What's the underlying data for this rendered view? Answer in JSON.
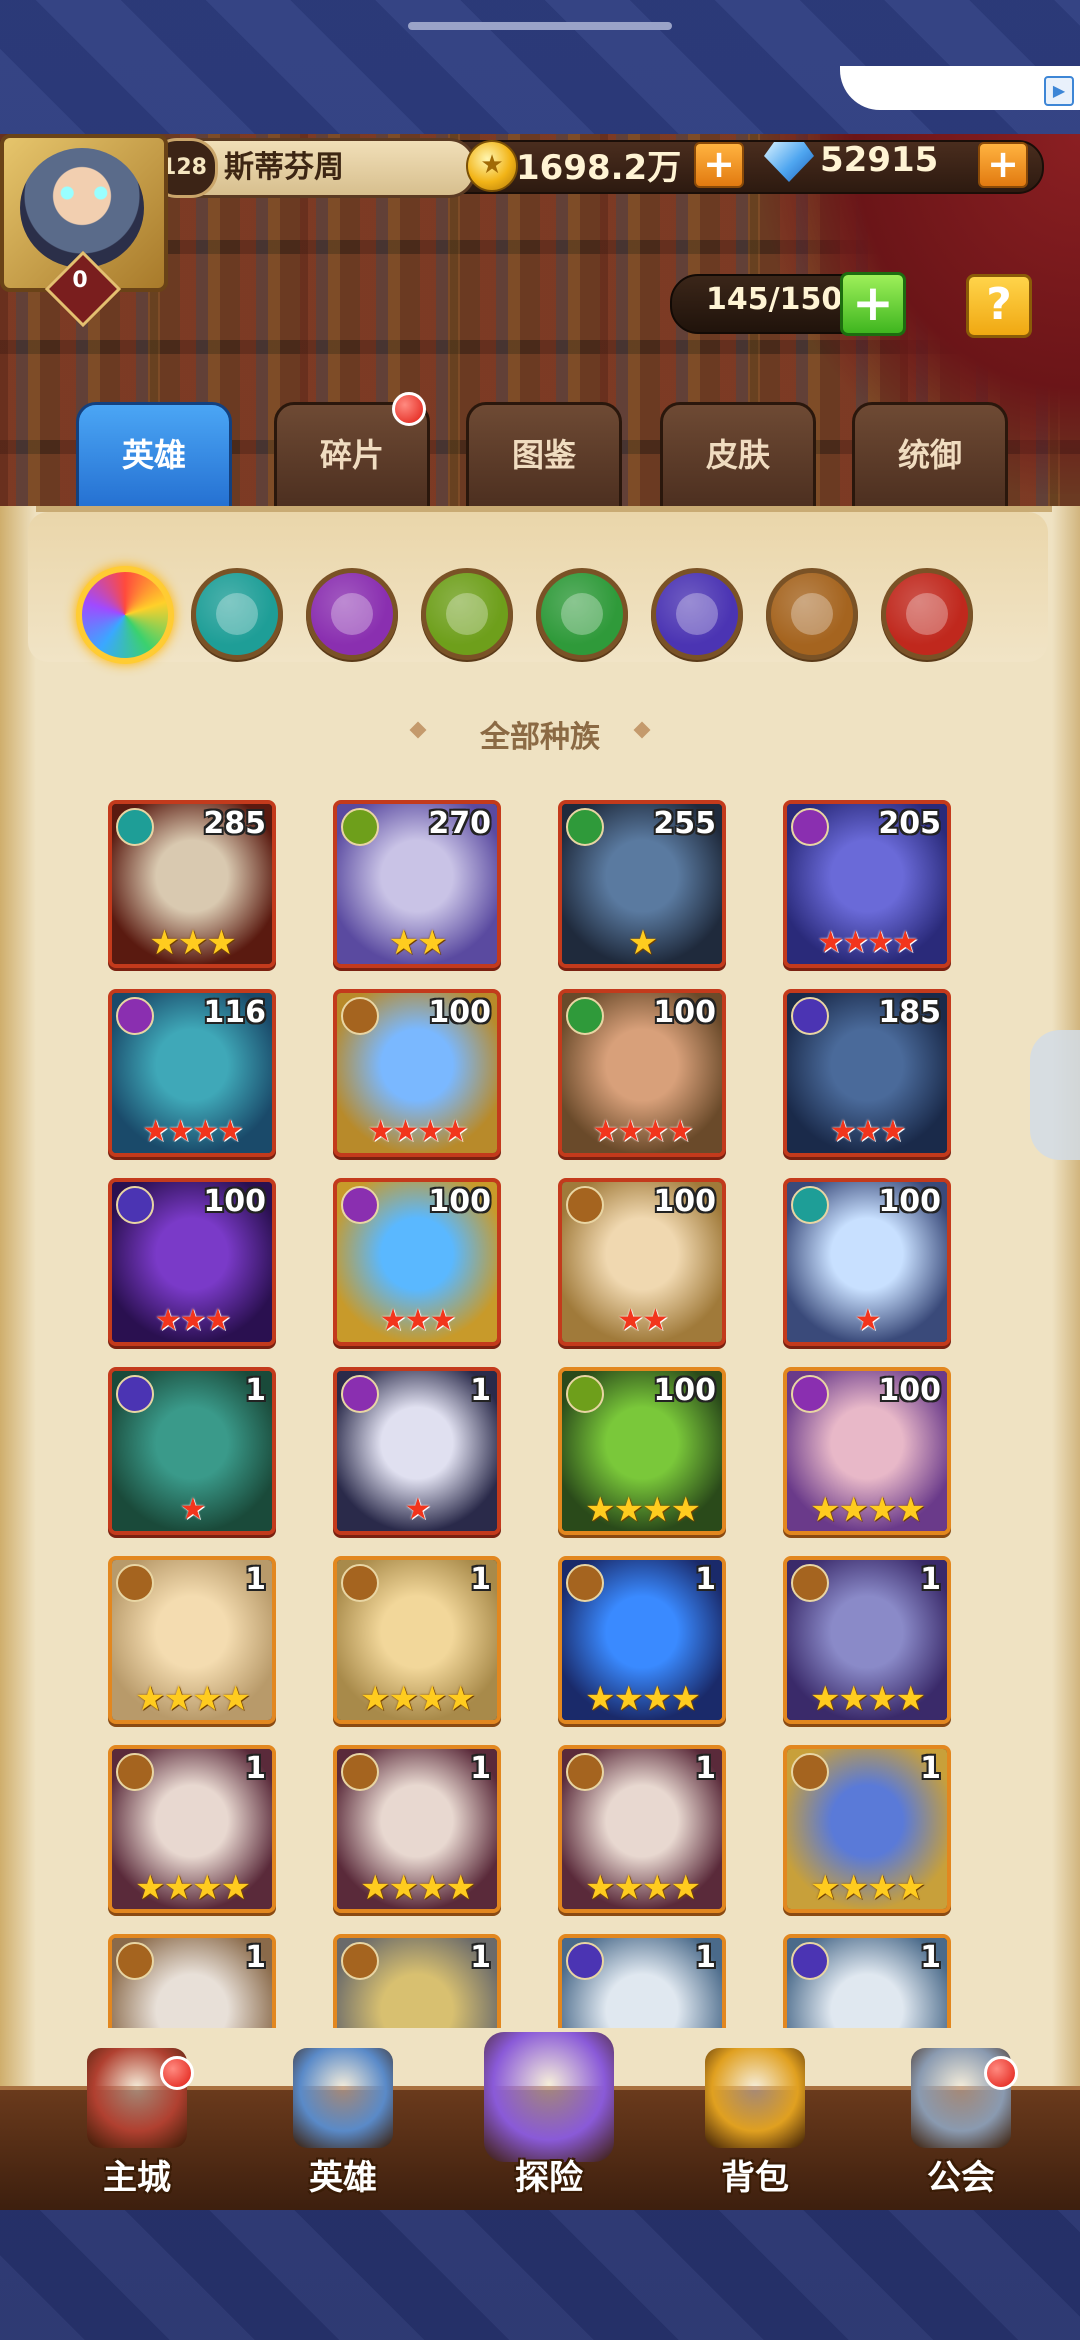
{
  "player": {
    "level": "128",
    "name": "斯蒂芬周",
    "vip": "0",
    "gold": "1698.2万",
    "gems": "52915",
    "hero_capacity": "145/150"
  },
  "icons": {
    "coin": "gold-coin-icon",
    "gem": "diamond-icon",
    "plus": "+",
    "help": "?",
    "star": "★"
  },
  "tabs": [
    {
      "label": "英雄",
      "active": true
    },
    {
      "label": "碎片",
      "badge": true
    },
    {
      "label": "图鉴"
    },
    {
      "label": "皮肤"
    },
    {
      "label": "统御"
    }
  ],
  "race_filters": [
    {
      "name": "all-races",
      "color": "#ff6a3d"
    },
    {
      "name": "shadow",
      "color": "#1e9e97"
    },
    {
      "name": "fortress",
      "color": "#8a2fb0"
    },
    {
      "name": "forest-eye",
      "color": "#6e9f1b"
    },
    {
      "name": "forest-leaf",
      "color": "#2f9a3a"
    },
    {
      "name": "abyss",
      "color": "#4b34b3"
    },
    {
      "name": "light",
      "color": "#a5641f"
    },
    {
      "name": "dark",
      "color": "#c0281d"
    }
  ],
  "filter_label": "全部种族",
  "heroes": [
    {
      "level": "285",
      "stars": "★★★",
      "star_type": "gold",
      "race_color": "#1e9e97",
      "frame": "red",
      "art": [
        "#d9c9b0",
        "#5a1a10"
      ]
    },
    {
      "level": "270",
      "stars": "★★",
      "star_type": "gold",
      "race_color": "#6e9f1b",
      "frame": "red",
      "art": [
        "#c9c3e6",
        "#5a4aa0"
      ]
    },
    {
      "level": "255",
      "stars": "★",
      "star_type": "gold",
      "race_color": "#2f9a3a",
      "frame": "red",
      "art": [
        "#5a7aa0",
        "#1f2a3c"
      ]
    },
    {
      "level": "205",
      "stars": "★★★★",
      "star_type": "red",
      "race_color": "#8a2fb0",
      "frame": "red",
      "art": [
        "#6a6ad8",
        "#2a2a7a"
      ]
    },
    {
      "level": "116",
      "stars": "★★★★",
      "star_type": "red",
      "race_color": "#8a2fb0",
      "frame": "red",
      "art": [
        "#3fa8b8",
        "#1a4a6a"
      ]
    },
    {
      "level": "100",
      "stars": "★★★★",
      "star_type": "red",
      "race_color": "#a5641f",
      "frame": "red",
      "art": [
        "#7ab8ff",
        "#b88a2a"
      ]
    },
    {
      "level": "100",
      "stars": "★★★★",
      "star_type": "red",
      "race_color": "#2f9a3a",
      "frame": "red",
      "art": [
        "#d8a07a",
        "#6a4a2a"
      ]
    },
    {
      "level": "185",
      "stars": "★★★",
      "star_type": "red",
      "race_color": "#4b34b3",
      "frame": "red",
      "art": [
        "#4a6a9a",
        "#1a2a4a"
      ]
    },
    {
      "level": "100",
      "stars": "★★★",
      "star_type": "red",
      "race_color": "#4b34b3",
      "frame": "red",
      "art": [
        "#7a3ac8",
        "#2a1050"
      ]
    },
    {
      "level": "100",
      "stars": "★★★",
      "star_type": "red",
      "race_color": "#8a2fb0",
      "frame": "red",
      "art": [
        "#5ab8ff",
        "#c89a2a"
      ]
    },
    {
      "level": "100",
      "stars": "★★",
      "star_type": "red",
      "race_color": "#a5641f",
      "frame": "red",
      "art": [
        "#f0d8b0",
        "#a07a3a"
      ]
    },
    {
      "level": "100",
      "stars": "★",
      "star_type": "red",
      "race_color": "#1e9e97",
      "frame": "red",
      "art": [
        "#c8e0ff",
        "#3a4a7a"
      ]
    },
    {
      "level": "1",
      "stars": "★",
      "star_type": "red",
      "race_color": "#4b34b3",
      "frame": "red",
      "art": [
        "#3a9a8a",
        "#1a4a3a"
      ]
    },
    {
      "level": "1",
      "stars": "★",
      "star_type": "red",
      "race_color": "#8a2fb0",
      "frame": "red",
      "art": [
        "#e0e0f0",
        "#2a2a4a"
      ]
    },
    {
      "level": "100",
      "stars": "★★★★",
      "star_type": "gold",
      "race_color": "#6e9f1b",
      "frame": "gold",
      "art": [
        "#7ac83a",
        "#2a4a1a"
      ]
    },
    {
      "level": "100",
      "stars": "★★★★",
      "star_type": "gold",
      "race_color": "#8a2fb0",
      "frame": "gold",
      "art": [
        "#e8b8c8",
        "#6a3a8a"
      ]
    },
    {
      "level": "1",
      "stars": "★★★★",
      "star_type": "gold",
      "race_color": "#a5641f",
      "frame": "gold",
      "art": [
        "#f4dcb0",
        "#b89a6a"
      ]
    },
    {
      "level": "1",
      "stars": "★★★★",
      "star_type": "gold",
      "race_color": "#a5641f",
      "frame": "gold",
      "art": [
        "#f2d79a",
        "#a88a4a"
      ]
    },
    {
      "level": "1",
      "stars": "★★★★",
      "star_type": "gold",
      "race_color": "#a5641f",
      "frame": "gold",
      "art": [
        "#3a8aff",
        "#1a2a6a"
      ]
    },
    {
      "level": "1",
      "stars": "★★★★",
      "star_type": "gold",
      "race_color": "#a5641f",
      "frame": "gold",
      "art": [
        "#8a8ac8",
        "#3a2a6a"
      ]
    },
    {
      "level": "1",
      "stars": "★★★★",
      "star_type": "gold",
      "race_color": "#a5641f",
      "frame": "gold",
      "art": [
        "#e8d8d0",
        "#5a2a3a"
      ]
    },
    {
      "level": "1",
      "stars": "★★★★",
      "star_type": "gold",
      "race_color": "#a5641f",
      "frame": "gold",
      "art": [
        "#e8d8d0",
        "#5a2a3a"
      ]
    },
    {
      "level": "1",
      "stars": "★★★★",
      "star_type": "gold",
      "race_color": "#a5641f",
      "frame": "gold",
      "art": [
        "#e8d8d0",
        "#5a2a3a"
      ]
    },
    {
      "level": "1",
      "stars": "★★★★",
      "star_type": "gold",
      "race_color": "#a5641f",
      "frame": "gold",
      "art": [
        "#5a7ad8",
        "#c8a03a"
      ]
    },
    {
      "level": "1",
      "stars": "",
      "star_type": "gold",
      "race_color": "#a5641f",
      "frame": "gold",
      "art": [
        "#e8e0d8",
        "#8a6a4a"
      ]
    },
    {
      "level": "1",
      "stars": "",
      "star_type": "gold",
      "race_color": "#a5641f",
      "frame": "gold",
      "art": [
        "#d8c070",
        "#6a6a6a"
      ]
    },
    {
      "level": "1",
      "stars": "",
      "star_type": "gold",
      "race_color": "#4b34b3",
      "frame": "gold",
      "art": [
        "#e0e8f0",
        "#4a6a8a"
      ]
    },
    {
      "level": "1",
      "stars": "",
      "star_type": "gold",
      "race_color": "#4b34b3",
      "frame": "gold",
      "art": [
        "#e0e8f0",
        "#4a6a8a"
      ]
    }
  ],
  "bottom_nav": [
    {
      "label": "主城",
      "badge": true,
      "color": "#b04030"
    },
    {
      "label": "英雄",
      "badge": false,
      "color": "#5a8ac8"
    },
    {
      "label": "探险",
      "badge": false,
      "color": "#8a5ad8"
    },
    {
      "label": "背包",
      "badge": false,
      "color": "#e0a020"
    },
    {
      "label": "公会",
      "badge": true,
      "color": "#8a9ab0"
    }
  ]
}
